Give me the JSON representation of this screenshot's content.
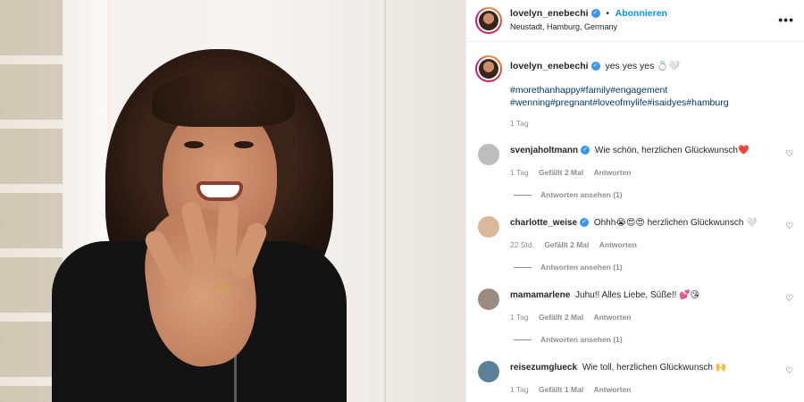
{
  "post": {
    "username": "lovelyn_enebechi",
    "follow_label": "Abonnieren",
    "location": "Neustadt, Hamburg, Germany",
    "more_label": "•••"
  },
  "caption": {
    "username": "lovelyn_enebechi",
    "text": "yes yes yes 💍🤍",
    "hashtags_line1": "#morethanhappy#family#engagement",
    "hashtags_line2": "#wenning#pregnant#loveofmylife#isaidyes#hamburg",
    "time": "1 Tag"
  },
  "comments": [
    {
      "username": "svenjaholtmann",
      "text": "Wie schön, herzlichen Glückwunsch❤️",
      "time": "1 Tag",
      "likes": "Gefällt 2 Mal",
      "reply_label": "Antworten",
      "view_replies": "Antworten ansehen (1)",
      "avatar_color": "#bdbdbd"
    },
    {
      "username": "charlotte_weise",
      "text": "Ohhh😭😍😍 herzlichen Glückwunsch 🤍",
      "time": "22 Std.",
      "likes": "Gefällt 2 Mal",
      "reply_label": "Antworten",
      "view_replies": "Antworten ansehen (1)",
      "avatar_color": "#d9b99a"
    },
    {
      "username": "mamamarlene",
      "text": "Juhu!! Alles Liebe, Süße!! 💕😘",
      "time": "1 Tag",
      "likes": "Gefällt 2 Mal",
      "reply_label": "Antworten",
      "view_replies": "Antworten ansehen (1)",
      "avatar_color": "#9c8b80"
    },
    {
      "username": "reisezumglueck",
      "text": "Wie toll, herzlichen Glückwunsch 🙌",
      "time": "1 Tag",
      "likes": "Gefällt 1 Mal",
      "reply_label": "Antworten",
      "avatar_color": "#5c7f9a"
    }
  ],
  "icons": {
    "verified": "✓",
    "heart": "♡"
  },
  "colors": {
    "link": "#0095f6",
    "hashtag": "#00376b",
    "muted": "#8e8e8e",
    "verified": "#3897f0"
  }
}
